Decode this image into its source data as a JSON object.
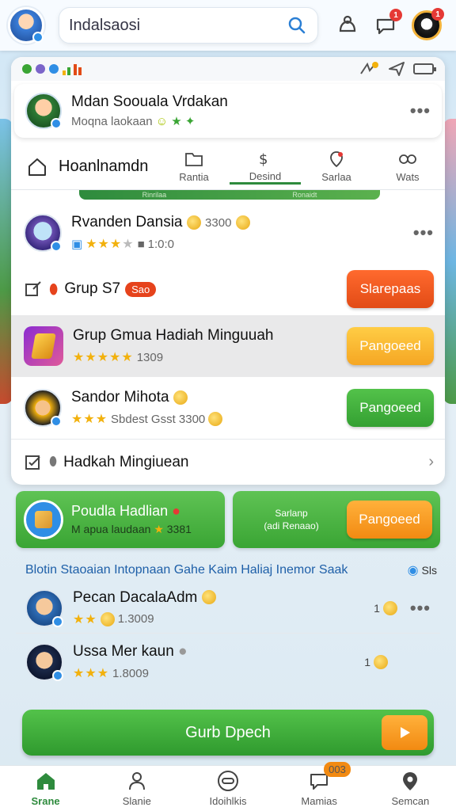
{
  "topbar": {
    "search_value": "Indalsaosi",
    "notif_count_1": "1",
    "notif_count_2": "1"
  },
  "profile": {
    "name": "Mdan Soouala Vrdakan",
    "sub": "Moqna laokaan"
  },
  "tabs": {
    "home_label": "Hoanlnamdn",
    "items": [
      {
        "label": "Rantia"
      },
      {
        "label": "Desind"
      },
      {
        "label": "Sarlaa"
      },
      {
        "label": "Wats"
      }
    ]
  },
  "strip_labels": [
    "Rinrilaa",
    "Ronaidt"
  ],
  "rows": [
    {
      "title": "Rvanden Dansia",
      "value": "3300",
      "meta": "1:0:0"
    },
    {
      "title": "Grup S7",
      "badge": "Sao",
      "button": "Slarepaas"
    },
    {
      "title": "Grup Gmua Hadiah Minguuah",
      "meta": "1309",
      "button": "Pangoeed"
    },
    {
      "title": "Sandor Mihota",
      "meta": "Sbdest Gsst 3300",
      "button": "Pangoeed"
    },
    {
      "title": "Hadkah Mingiuean"
    }
  ],
  "promo": {
    "left_title": "Poudla Hadlian",
    "left_sub": "M apua laudaan",
    "left_value": "3381",
    "right_desc_1": "Sarlanp",
    "right_desc_2": "(adi Renaao)",
    "right_button": "Pangoeed"
  },
  "info": {
    "text": "Blotin Staoaian Intopnaan Gahe Kaim Haliaj Inemor Saak",
    "tag": "Sls"
  },
  "lower": [
    {
      "title": "Pecan DacalaAdm",
      "meta": "1.3009",
      "count": "1"
    },
    {
      "title": "Ussa Mer kaun",
      "meta": "1.8009",
      "count": "1"
    }
  ],
  "cta": {
    "label": "Gurb Dpech"
  },
  "bottom_nav": [
    {
      "label": "Srane"
    },
    {
      "label": "Slanie"
    },
    {
      "label": "Idoihlkis"
    },
    {
      "label": "Mamias",
      "badge": "003"
    },
    {
      "label": "Semcan"
    }
  ],
  "colors": {
    "primary_green": "#3aa534",
    "accent_orange": "#f28a12",
    "accent_red": "#e24b16",
    "link_blue": "#1e5fa8"
  }
}
